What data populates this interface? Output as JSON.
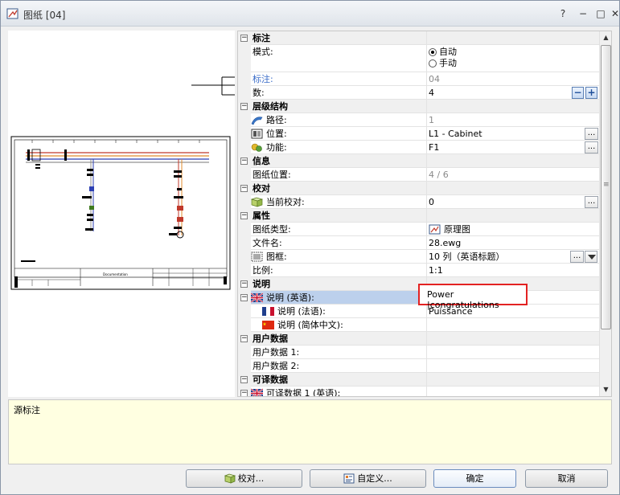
{
  "window": {
    "title": "图纸 [04]"
  },
  "preview": {
    "title_block_text": "Documentation"
  },
  "grid": {
    "rows": [
      {
        "type": "cat",
        "label": "标注",
        "toggle": "−"
      },
      {
        "type": "prop",
        "label": "模式:",
        "radio": [
          "自动",
          "手动"
        ],
        "radio_selected": 0
      },
      {
        "type": "prop",
        "label": "标注:",
        "value": "04",
        "label_style": "blue",
        "value_style": "grey"
      },
      {
        "type": "prop",
        "label": "数:",
        "value": "4",
        "spin": true
      },
      {
        "type": "cat",
        "label": "层级结构",
        "toggle": "−"
      },
      {
        "type": "prop",
        "label": "路径:",
        "value": "1",
        "icon": "path-icon",
        "value_style": "grey"
      },
      {
        "type": "prop",
        "label": "位置:",
        "value": "L1 - Cabinet",
        "icon": "location-icon",
        "ellipsis": true
      },
      {
        "type": "prop",
        "label": "功能:",
        "value": "F1",
        "icon": "function-icon",
        "ellipsis": true
      },
      {
        "type": "cat",
        "label": "信息",
        "toggle": "−"
      },
      {
        "type": "prop",
        "label": "图纸位置:",
        "value": "4 / 6",
        "value_style": "grey"
      },
      {
        "type": "cat",
        "label": "校对",
        "toggle": "−"
      },
      {
        "type": "prop",
        "label": "当前校对:",
        "value": "0",
        "icon": "revision-icon",
        "ellipsis": true
      },
      {
        "type": "cat",
        "label": "属性",
        "toggle": "−"
      },
      {
        "type": "prop",
        "label": "图纸类型:",
        "value": "原理图",
        "value_icon": "schematic-icon"
      },
      {
        "type": "prop",
        "label": "文件名:",
        "value": "28.ewg"
      },
      {
        "type": "prop",
        "label": "图框:",
        "value": "10 列（英语标题）",
        "icon": "frame-icon",
        "ellipsis": true,
        "dropdown": true
      },
      {
        "type": "prop",
        "label": "比例:",
        "value": "1:1"
      },
      {
        "type": "cat",
        "label": "说明",
        "toggle": "−"
      },
      {
        "type": "prop",
        "label": "说明 (英语):",
        "value": "",
        "icon": "uk-flag-icon",
        "toggle": "−",
        "selected": true
      },
      {
        "type": "prop",
        "label": "说明 (法语):",
        "value": "Puissance",
        "icon": "fr-flag-icon",
        "indent": true
      },
      {
        "type": "prop",
        "label": "说明 (简体中文):",
        "value": "",
        "icon": "cn-flag-icon",
        "indent": true
      },
      {
        "type": "cat",
        "label": "用户数据",
        "toggle": "−"
      },
      {
        "type": "prop",
        "label": "用户数据 1:",
        "value": ""
      },
      {
        "type": "prop",
        "label": "用户数据 2:",
        "value": ""
      },
      {
        "type": "cat",
        "label": "可译数据",
        "toggle": "−"
      },
      {
        "type": "prop",
        "label": "可译数据 1 (英语):",
        "value": "",
        "icon": "uk-flag-icon",
        "toggle": "−"
      }
    ]
  },
  "editor": {
    "value": "Power |congratulations"
  },
  "description": {
    "text": "源标注"
  },
  "buttons": {
    "revision": "校对...",
    "customize": "自定义...",
    "ok": "确定",
    "cancel": "取消"
  },
  "colors": {
    "highlight": "#e32222",
    "selection": "#bcd0ec",
    "desc_bg": "#ffffe1"
  }
}
